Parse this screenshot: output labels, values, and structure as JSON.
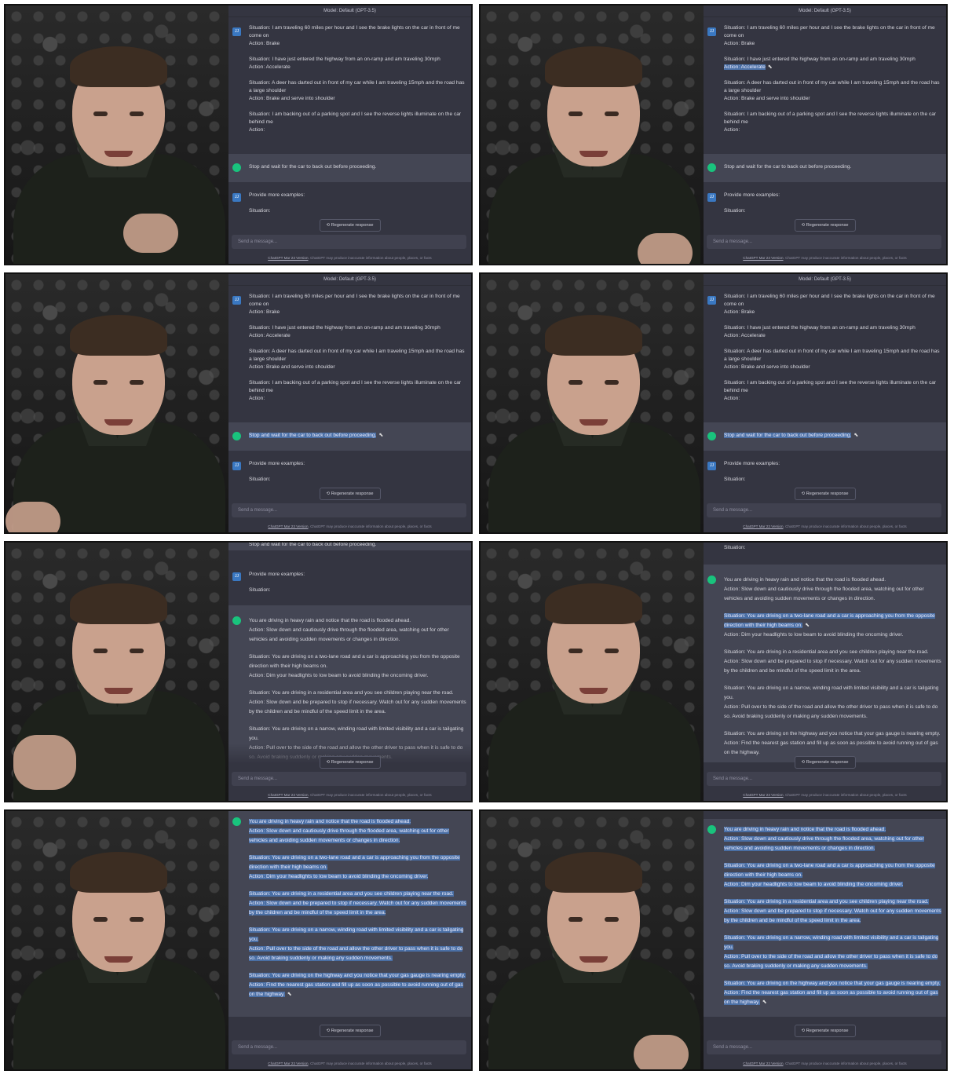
{
  "model_bar": "Model: Default (GPT-3.5)",
  "user_initials": "JJ",
  "prompt": {
    "s1": "Situation: I am traveling 60 miles per hour and I see the brake lights on the car in front of me come on",
    "a1": "Action: Brake",
    "s2": "Situation: I have just entered the highway from an on-ramp and am traveling 30mph",
    "a2": "Action: Accelerate",
    "s3": "Situation: A deer has darted out in front of my car while I am traveling 15mph and the road has a large shoulder",
    "a3": "Action: Brake and serve into shoulder",
    "s4": "Situation: I am backing out of a parking spot and I see the reverse lights illuminate on the car behind me",
    "a4": "Action:"
  },
  "response_1": "Stop and wait for the car to back out before proceeding.",
  "followup": "Provide more examples:",
  "followup_situation": "Situation:",
  "examples": {
    "e1": "You are driving in heavy rain and notice that the road is flooded ahead.",
    "e1a": "Action: Slow down and cautiously drive through the flooded area, watching out for other vehicles and avoiding sudden movements or changes in direction.",
    "e2": "Situation: You are driving on a two-lane road and a car is approaching you from the opposite direction with their high beams on.",
    "e2a": "Action: Dim your headlights to low beam to avoid blinding the oncoming driver.",
    "e3": "Situation: You are driving in a residential area and you see children playing near the road.",
    "e3a": "Action: Slow down and be prepared to stop if necessary. Watch out for any sudden movements by the children and be mindful of the speed limit in the area.",
    "e4": "Situation: You are driving on a narrow, winding road with limited visibility and a car is tailgating you.",
    "e4a": "Action: Pull over to the side of the road and allow the other driver to pass when it is safe to do so. Avoid braking suddenly or making any sudden movements.",
    "e5": "Situation: You are driving on the highway and you notice that your gas gauge is nearing empty.",
    "e5a": "Action: Find the nearest gas station and fill up as soon as possible to avoid running out of gas on the highway."
  },
  "regenerate": "Regenerate response",
  "regenerate_icon": "refresh-icon",
  "input_placeholder": "Send a message...",
  "footer_link": "ChatGPT Mar 23 Version",
  "footer_text": ". ChatGPT may produce inaccurate information about people, places, or facts",
  "cursor_icon": "mouse-pointer-icon",
  "cursor_glyph": "⬉",
  "regen_glyph": "⟲"
}
